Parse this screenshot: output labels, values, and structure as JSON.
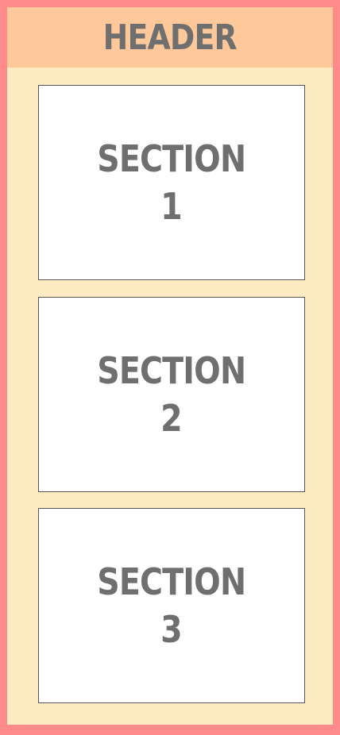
{
  "header": {
    "title": "HEADER"
  },
  "sections": [
    {
      "label": "SECTION",
      "number": "1"
    },
    {
      "label": "SECTION",
      "number": "2"
    },
    {
      "label": "SECTION",
      "number": "3"
    }
  ],
  "colors": {
    "outer_border": "#ff8a8a",
    "header_background": "#ffc89a",
    "page_background": "#ffebc1",
    "section_background": "#ffffff",
    "text": "#6f6f6f"
  }
}
